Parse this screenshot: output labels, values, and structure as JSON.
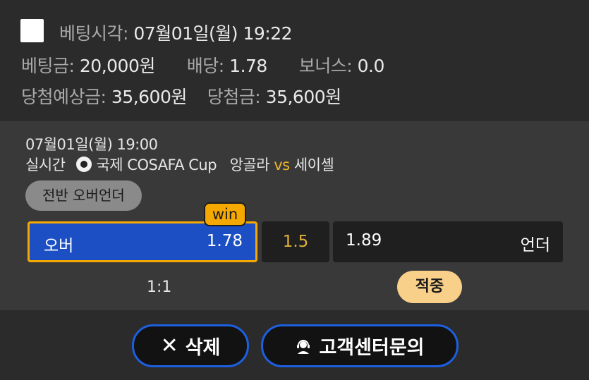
{
  "bet": {
    "time_label": "베팅시각:",
    "time_value": "07월01일(월) 19:22",
    "amount_label": "베팅금:",
    "amount_value": "20,000원",
    "odds_label": "배당:",
    "odds_value": "1.78",
    "bonus_label": "보너스:",
    "bonus_value": "0.0",
    "expected_label": "당첨예상금:",
    "expected_value": "35,600원",
    "won_label": "당첨금:",
    "won_value": "35,600원"
  },
  "match": {
    "datetime": "07월01일(월) 19:00",
    "type": "실시간",
    "sport_icon": "soccer-ball-icon",
    "league": "국제 COSAFA Cup",
    "home": "앙골라",
    "vs": "vs",
    "away": "세이셸",
    "market": "전반 오버언더",
    "win_badge": "win",
    "over_label": "오버",
    "over_odds": "1.78",
    "line": "1.5",
    "under_odds": "1.89",
    "under_label": "언더",
    "score": "1:1",
    "result": "적중"
  },
  "actions": {
    "delete_icon": "close-icon",
    "delete_label": "삭제",
    "support_icon": "headset-icon",
    "support_label": "고객센터문의"
  },
  "colors": {
    "selected_bg": "#1d4fc4",
    "selected_border": "#f5a800",
    "accent": "#f5a800",
    "button_border": "#1d5fe0",
    "result_pill": "#f9d089"
  }
}
